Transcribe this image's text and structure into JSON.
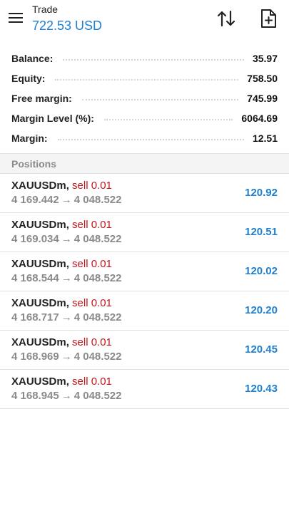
{
  "header": {
    "title": "Trade",
    "subtitle": "722.53 USD"
  },
  "account": [
    {
      "label": "Balance:",
      "value": "35.97"
    },
    {
      "label": "Equity:",
      "value": "758.50"
    },
    {
      "label": "Free margin:",
      "value": "745.99"
    },
    {
      "label": "Margin Level (%):",
      "value": "6064.69"
    },
    {
      "label": "Margin:",
      "value": "12.51"
    }
  ],
  "positions_section": {
    "title": "Positions"
  },
  "positions": [
    {
      "symbol": "XAUUSDm",
      "action": "sell 0.01",
      "open_price": "4 169.442",
      "arrow": "→",
      "current_price": "4 048.522",
      "profit": "120.92"
    },
    {
      "symbol": "XAUUSDm",
      "action": "sell 0.01",
      "open_price": "4 169.034",
      "arrow": "→",
      "current_price": "4 048.522",
      "profit": "120.51"
    },
    {
      "symbol": "XAUUSDm",
      "action": "sell 0.01",
      "open_price": "4 168.544",
      "arrow": "→",
      "current_price": "4 048.522",
      "profit": "120.02"
    },
    {
      "symbol": "XAUUSDm",
      "action": "sell 0.01",
      "open_price": "4 168.717",
      "arrow": "→",
      "current_price": "4 048.522",
      "profit": "120.20"
    },
    {
      "symbol": "XAUUSDm",
      "action": "sell 0.01",
      "open_price": "4 168.969",
      "arrow": "→",
      "current_price": "4 048.522",
      "profit": "120.45"
    },
    {
      "symbol": "XAUUSDm",
      "action": "sell 0.01",
      "open_price": "4 168.945",
      "arrow": "→",
      "current_price": "4 048.522",
      "profit": "120.43"
    }
  ],
  "icons": {
    "menu": "menu-icon",
    "sort": "sort-arrows-icon",
    "new_order": "new-document-icon"
  },
  "colors": {
    "accent": "#1e7fd0",
    "sell": "#c0161c",
    "muted": "#8a8a8a"
  }
}
